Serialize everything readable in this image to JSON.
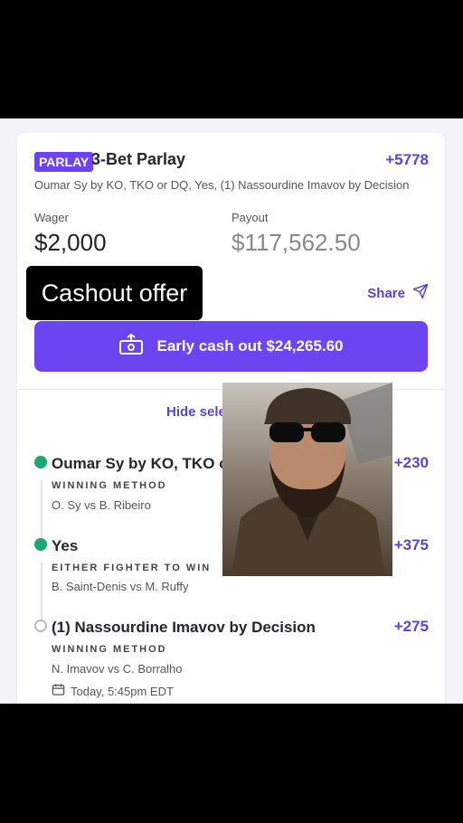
{
  "bet": {
    "badge": "PARLAY",
    "title": "3-Bet Parlay",
    "odds": "+5778",
    "subtitle": "Oumar Sy by KO, TKO or DQ, Yes, (1) Nassourdine Imavov by Decision",
    "wager_label": "Wager",
    "wager_value": "$2,000",
    "payout_label": "Payout",
    "payout_value": "$117,562.50",
    "share_label": "Share",
    "cashout_button": "Early cash out $24,265.60",
    "hide_selections": "Hide selections"
  },
  "selections": [
    {
      "name": "Oumar Sy by KO, TKO or DQ",
      "odds": "+230",
      "market": "WINNING METHOD",
      "matchup": "O. Sy vs B. Ribeiro",
      "status": "won"
    },
    {
      "name": "Yes",
      "odds": "+375",
      "market": "EITHER FIGHTER TO WIN",
      "matchup": "B. Saint-Denis vs M. Ruffy",
      "status": "won"
    },
    {
      "name": "(1) Nassourdine Imavov by Decision",
      "odds": "+275",
      "market": "WINNING METHOD",
      "matchup": "N. Imavov vs C. Borralho",
      "time": "Today, 5:45pm EDT",
      "status": "pending"
    }
  ],
  "overlay": {
    "caption": "Cashout offer"
  },
  "colors": {
    "accent": "#6d45f0",
    "success": "#1aa86f",
    "odds": "#5c42d6"
  },
  "icons": [
    "cash-out-icon",
    "share-send-icon",
    "check-circle-icon",
    "calendar-icon"
  ]
}
